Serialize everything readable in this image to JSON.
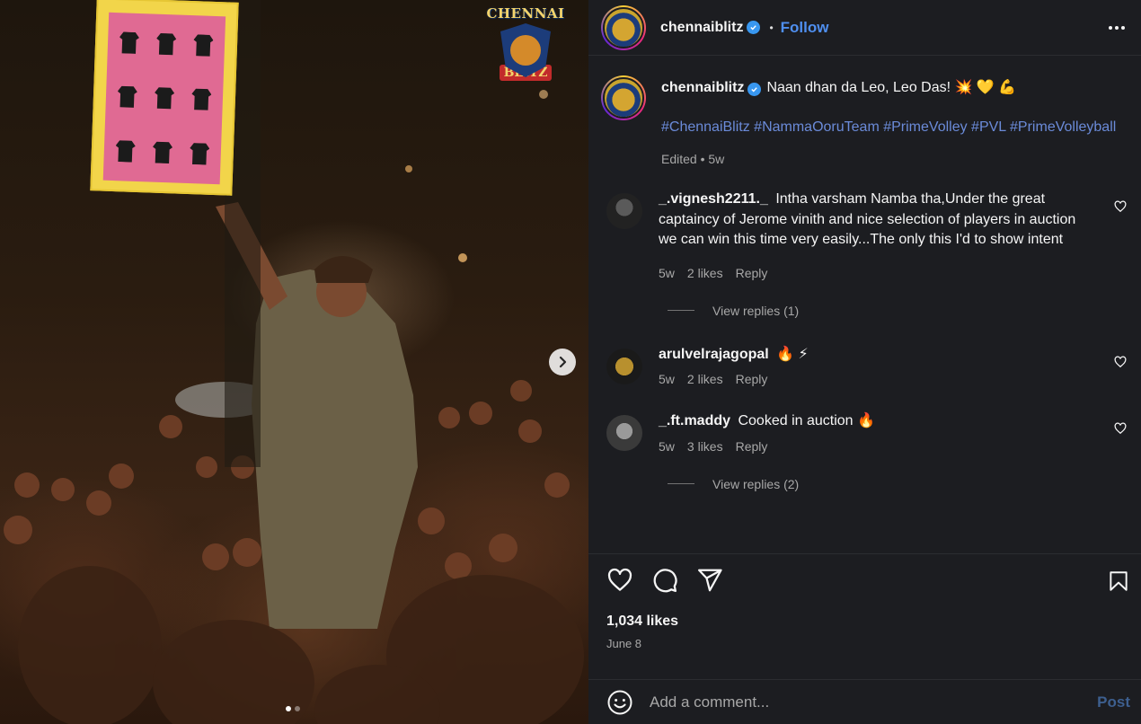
{
  "header": {
    "username": "chennaiblitz",
    "follow_label": "Follow",
    "separator": "•"
  },
  "media": {
    "logo_top": "CHENNAI",
    "logo_bottom": "BLITZ",
    "slide_count": 2,
    "active_slide": 0
  },
  "caption": {
    "username": "chennaiblitz",
    "text": "Naan dhan da Leo, Leo Das! 💥 💛 💪",
    "hashtags": "#ChennaiBlitz #NammaOoruTeam #PrimeVolley #PVL #PrimeVolleyball",
    "meta": "Edited • 5w"
  },
  "comments": [
    {
      "username": "_.vignesh2211._",
      "text": "Intha varsham Namba tha,Under the great captaincy of Jerome vinith and nice selection of players in auction we can win this time very easily...The only this I'd to show intent",
      "time": "5w",
      "likes": "2 likes",
      "reply_label": "Reply",
      "view_replies": "View replies (1)"
    },
    {
      "username": "arulvelrajagopal",
      "text": "🔥 ⚡",
      "time": "5w",
      "likes": "2 likes",
      "reply_label": "Reply"
    },
    {
      "username": "_.ft.maddy",
      "text": "Cooked in auction 🔥",
      "time": "5w",
      "likes": "3 likes",
      "reply_label": "Reply",
      "view_replies": "View replies (2)"
    }
  ],
  "actions": {
    "likes": "1,034 likes",
    "date": "June 8"
  },
  "add_comment": {
    "placeholder": "Add a comment...",
    "post_label": "Post"
  },
  "colors": {
    "panel_bg": "#1c1d21",
    "link_blue": "#4f8ff0",
    "hashtag_blue": "#6b8bd9",
    "muted_text": "#a8a8a8",
    "verified_blue": "#3897f0"
  }
}
